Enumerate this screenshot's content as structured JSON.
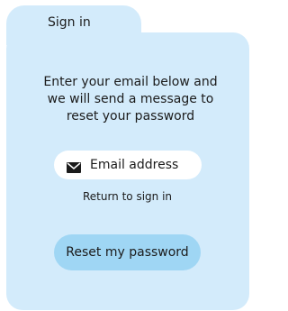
{
  "tab": {
    "title": "Sign in"
  },
  "message": {
    "line1": "Enter your email below and",
    "line2": "we will send a message to",
    "line3": "reset your password"
  },
  "email_field": {
    "placeholder": "Email address",
    "value": "",
    "icon": "envelope-icon"
  },
  "return_link": {
    "label": "Return to sign in"
  },
  "reset_button": {
    "label": "Reset my password"
  },
  "colors": {
    "panel": "#d3ebfb",
    "button": "#9fd6f4",
    "field": "#ffffff",
    "text": "#1b1b1b"
  }
}
